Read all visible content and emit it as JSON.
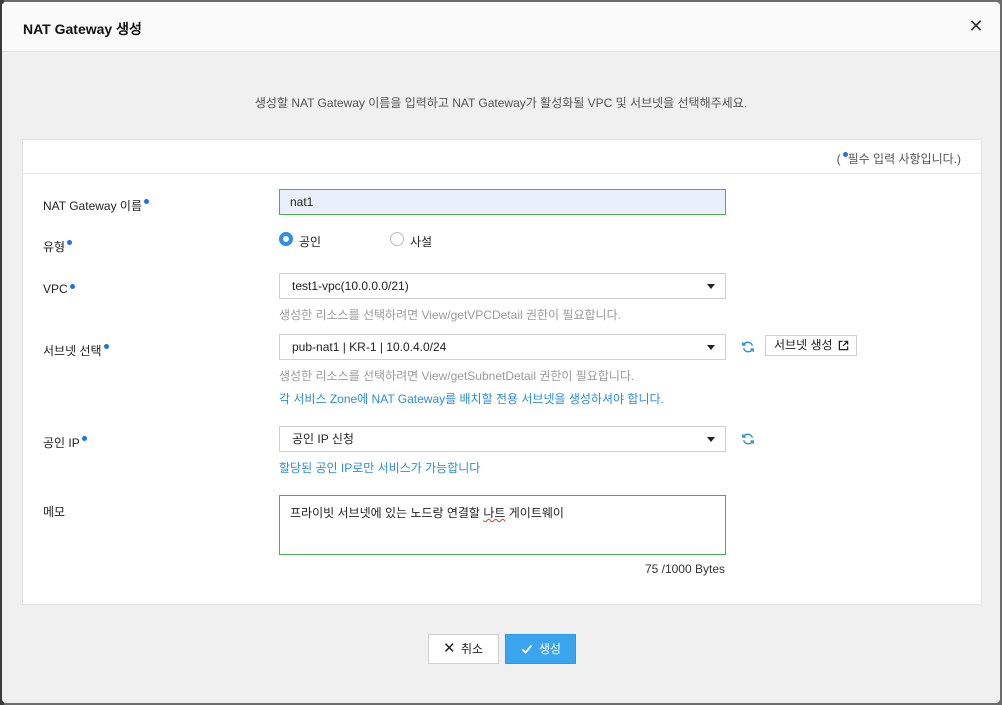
{
  "dialog": {
    "title": "NAT Gateway 생성",
    "close_icon": "close-icon",
    "intro": "생성할 NAT Gateway 이름을 입력하고 NAT Gateway가 활성화될 VPC 및 서브넷을 선택해주세요.",
    "required_note_open": "(",
    "required_note_text": "필수 입력 사항입니다.)"
  },
  "form": {
    "name": {
      "label": "NAT Gateway 이름",
      "value": "nat1"
    },
    "type": {
      "label": "유형",
      "options": [
        "공인",
        "사설"
      ],
      "selected": "공인"
    },
    "vpc": {
      "label": "VPC",
      "selected": "test1-vpc(10.0.0.0/21)",
      "help": "생성한 리소스를 선택하려면 View/getVPCDetail 권한이 필요합니다."
    },
    "subnet": {
      "label": "서브넷 선택",
      "selected": "pub-nat1 | KR-1 | 10.0.4.0/24",
      "help": "생성한 리소스를 선택하려면 View/getSubnetDetail 권한이 필요합니다.",
      "info": "각 서비스 Zone에 NAT Gateway를 배치할 전용 서브넷을 생성하셔야 합니다.",
      "create_button": "서브넷 생성"
    },
    "public_ip": {
      "label": "공인 IP",
      "selected": "공인 IP 신청",
      "info": "할당된 공인 IP로만 서비스가 가능합니다"
    },
    "memo": {
      "label": "메모",
      "value_before": "프라이빗 서브넷에 있는 노드랑 연결할 ",
      "value_squiggle": "나트",
      "value_after": " 게이트웨이",
      "byte_count": "75 /1000 Bytes"
    }
  },
  "footer": {
    "cancel_label": "취소",
    "create_label": "생성"
  },
  "colors": {
    "accent": "#3aa5ee",
    "required_dot": "#1a73e8",
    "valid_border": "#4cae4c",
    "info_text": "#2b8ed8"
  }
}
